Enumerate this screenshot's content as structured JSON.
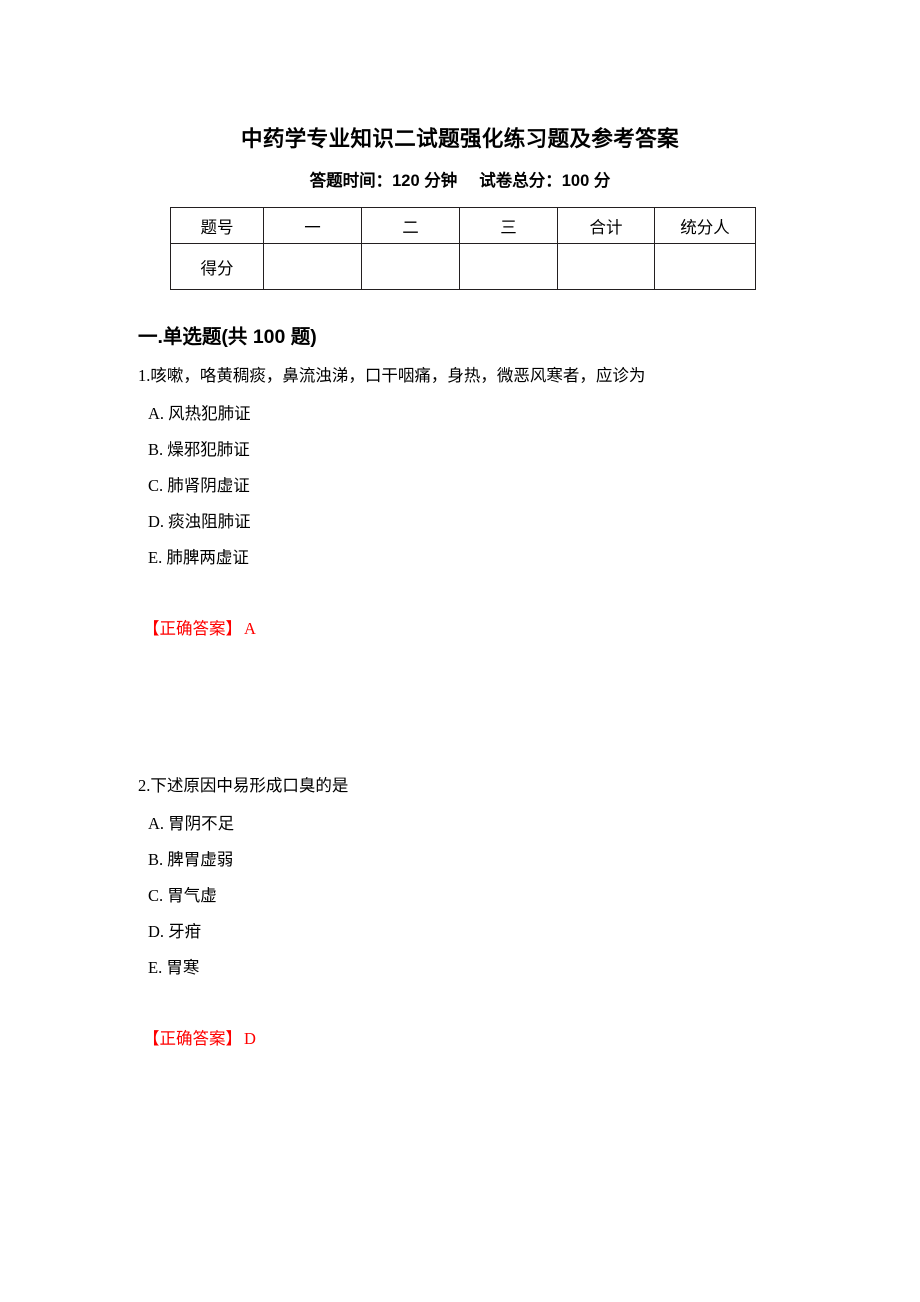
{
  "document": {
    "title": "中药学专业知识二试题强化练习题及参考答案",
    "subtitle_time": "答题时间：120 分钟",
    "subtitle_total": "试卷总分：100 分"
  },
  "score_table": {
    "headers": [
      "题号",
      "一",
      "二",
      "三",
      "合计",
      "统分人"
    ],
    "rows": [
      {
        "label": "得分",
        "cells": [
          "",
          "",
          "",
          "",
          ""
        ]
      }
    ]
  },
  "section": {
    "heading": "一.单选题(共 100 题)"
  },
  "questions": [
    {
      "number": "1",
      "stem": "1.咳嗽，咯黄稠痰，鼻流浊涕，口干咽痛，身热，微恶风寒者，应诊为",
      "options": [
        "A. 风热犯肺证",
        "B. 燥邪犯肺证",
        "C. 肺肾阴虚证",
        "D. 痰浊阻肺证",
        "E. 肺脾两虚证"
      ],
      "answer_label": "【正确答案】",
      "answer_value": "A"
    },
    {
      "number": "2",
      "stem": "2.下述原因中易形成口臭的是",
      "options": [
        "A. 胃阴不足",
        "B. 脾胃虚弱",
        "C. 胃气虚",
        "D. 牙疳",
        "E. 胃寒"
      ],
      "answer_label": "【正确答案】",
      "answer_value": "D"
    }
  ],
  "colors": {
    "answer_red": "#ff0000",
    "text_black": "#000000",
    "table_border": "#231f20"
  }
}
